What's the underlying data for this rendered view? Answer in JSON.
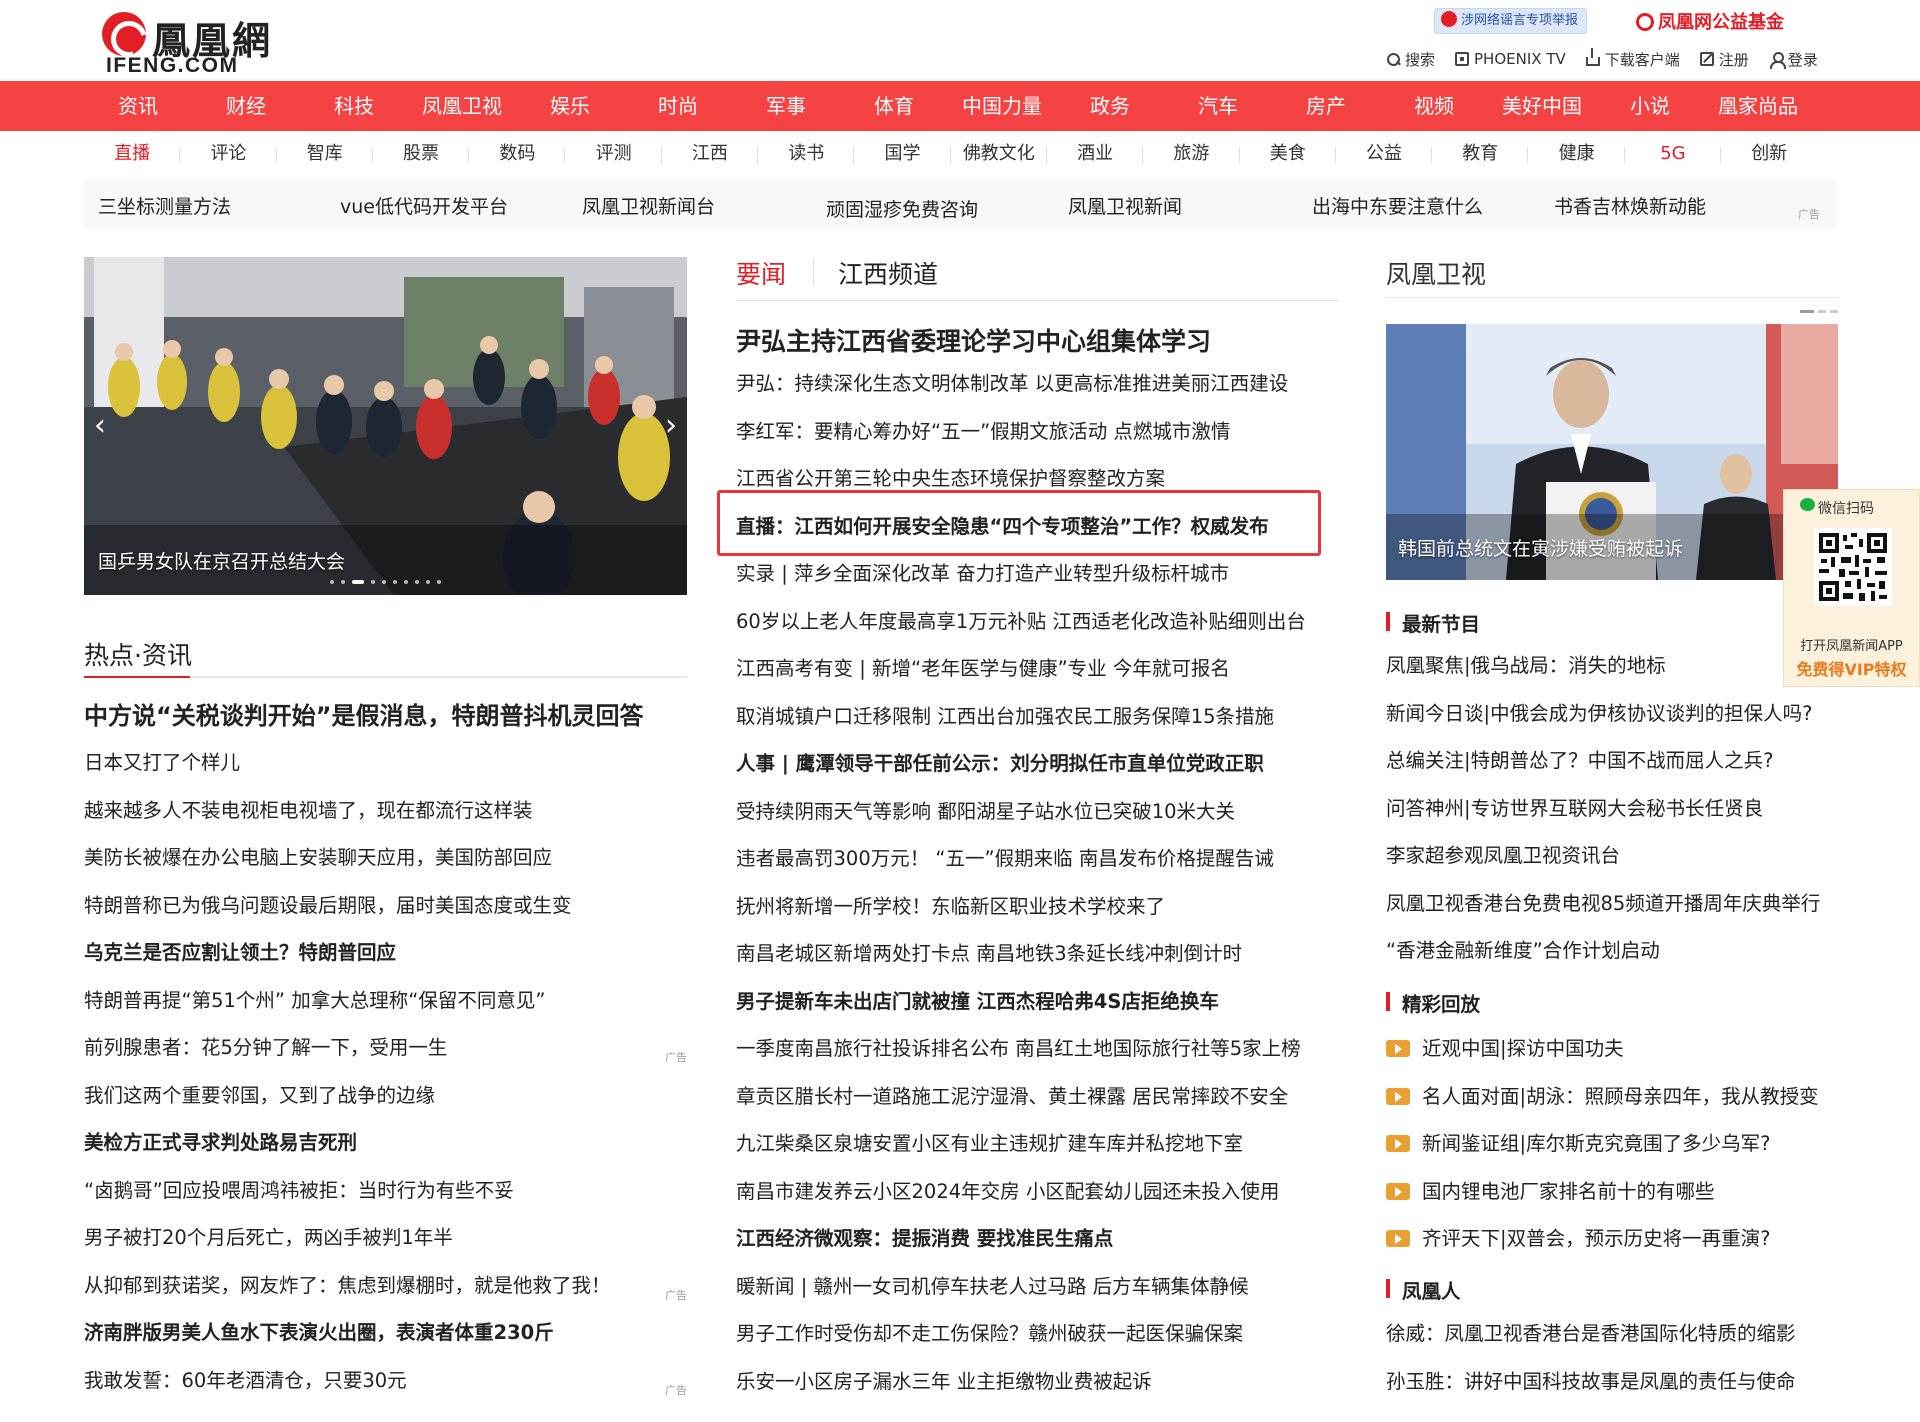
{
  "header": {
    "logo_cn": "鳳凰網",
    "logo_en": "IFENG.COM",
    "report_badge": "涉网络谣言专项举报",
    "fund": "凤凰网公益基金",
    "top_links": [
      "搜索",
      "PHOENIX TV",
      "下载客户端",
      "注册",
      "登录"
    ]
  },
  "nav_main": [
    "资讯",
    "财经",
    "科技",
    "凤凰卫视",
    "娱乐",
    "时尚",
    "军事",
    "体育",
    "中国力量",
    "政务",
    "汽车",
    "房产",
    "视频",
    "美好中国",
    "小说",
    "凰家尚品"
  ],
  "nav_sub": [
    "直播",
    "评论",
    "智库",
    "股票",
    "数码",
    "评测",
    "江西",
    "读书",
    "国学",
    "佛教文化",
    "酒业",
    "旅游",
    "美食",
    "公益",
    "教育",
    "健康",
    "5G",
    "创新"
  ],
  "ad_links": [
    "三坐标测量方法",
    "vue低代码开发平台",
    "凤凰卫视新闻台",
    "顽固湿疹免费咨询",
    "凤凰卫视新闻",
    "出海中东要注意什么",
    "书香吉林焕新动能"
  ],
  "ad_label": "广告",
  "slider": {
    "caption": "国乒男女队在京召开总结大会",
    "prev": "‹",
    "next": "›"
  },
  "hot": {
    "title": "热点·资讯",
    "items": [
      "中方说“关税谈判开始”是假消息，特朗普抖机灵回答",
      "日本又打了个样儿",
      "越来越多人不装电视柜电视墙了，现在都流行这样装",
      "美防长被爆在办公电脑上安装聊天应用，美国防部回应",
      "特朗普称已为俄乌问题设最后期限，届时美国态度或生变",
      "乌克兰是否应割让领土？特朗普回应",
      "特朗普再提“第51个州” 加拿大总理称“保留不同意见”",
      "前列腺患者：花5分钟了解一下，受用一生",
      "我们这两个重要邻国，又到了战争的边缘",
      "美检方正式寻求判处路易吉死刑",
      "“卤鹅哥”回应投喂周鸿祎被拒：当时行为有些不妥",
      "男子被打20个月后死亡，两凶手被判1年半",
      "从抑郁到获诺奖，网友炸了：焦虑到爆棚时，就是他救了我！",
      "济南胖版男美人鱼水下表演火出圈，表演者体重230斤",
      "我敢发誓：60年老酒清仓，只要30元"
    ]
  },
  "mid": {
    "tab1": "要闻",
    "tab2": "江西频道",
    "lead": "尹弘主持江西省委理论学习中心组集体学习",
    "items": [
      "尹弘：持续深化生态文明体制改革 以更高标准推进美丽江西建设",
      "李红军：要精心筹办好“五一”假期文旅活动 点燃城市激情",
      "江西省公开第三轮中央生态环境保护督察整改方案",
      "直播：江西如何开展安全隐患“四个专项整治”工作？权威发布",
      "实录 | 萍乡全面深化改革 奋力打造产业转型升级标杆城市",
      "60岁以上老人年度最高享1万元补贴 江西适老化改造补贴细则出台",
      "江西高考有变 |    新增“老年医学与健康”专业 今年就可报名",
      "取消城镇户口迁移限制 江西出台加强农民工服务保障15条措施",
      "人事 |   鹰潭领导干部任前公示：刘分明拟任市直单位党政正职",
      "受持续阴雨天气等影响 鄱阳湖星子站水位已突破10米大关",
      "违者最高罚300万元！ “五一”假期来临 南昌发布价格提醒告诫",
      "抚州将新增一所学校！东临新区职业技术学校来了",
      "南昌老城区新增两处打卡点    南昌地铁3条延长线冲刺倒计时",
      "男子提新车未出店门就被撞 江西杰程哈弗4S店拒绝换车",
      "一季度南昌旅行社投诉排名公布 南昌红土地国际旅行社等5家上榜",
      "章贡区腊长村一道路施工泥泞湿滑、黄土裸露 居民常摔跤不安全",
      "九江柴桑区泉塘安置小区有业主违规扩建车库并私挖地下室",
      "南昌市建发养云小区2024年交房 小区配套幼儿园还未投入使用",
      "江西经济微观察：提振消费 要找准民生痛点",
      "暖新闻 |    赣州一女司机停车扶老人过马路 后方车辆集体静候",
      "男子工作时受伤却不走工伤保险？赣州破获一起医保骗保案",
      "乐安一小区房子漏水三年 业主拒缴物业费被起诉"
    ]
  },
  "right": {
    "title": "凤凰卫视",
    "tv_caption": "韩国前总统文在寅涉嫌受贿被起诉",
    "sec1": "最新节目",
    "sec1_items": [
      "凤凰聚焦|俄乌战局：消失的地标",
      "新闻今日谈|中俄会成为伊核协议谈判的担保人吗?",
      "总编关注|特朗普怂了？中国不战而屈人之兵?",
      "问答神州|专访世界互联网大会秘书长任贤良",
      "李家超参观凤凰卫视资讯台",
      "凤凰卫视香港台免费电视85频道开播周年庆典举行",
      "“香港金融新维度”合作计划启动"
    ],
    "sec2": "精彩回放",
    "sec2_items": [
      "近观中国|探访中国功夫",
      "名人面对面|胡泳：照顾母亲四年，我从教授变",
      "新闻鉴证组|库尔斯克究竟围了多少乌军?",
      "国内锂电池厂家排名前十的有哪些",
      "齐评天下|双普会，预示历史将一再重演?"
    ],
    "sec3": "凤凰人",
    "sec3_items": [
      "徐威：凤凰卫视香港台是香港国际化特质的缩影",
      "孙玉胜：讲好中国科技故事是凤凰的责任与使命"
    ]
  },
  "qr": {
    "title": "微信扫码",
    "line1": "打开凤凰新闻APP",
    "line2": "免费得VIP特权"
  },
  "colors": {
    "brand_red": "#e21f26",
    "nav_red": "#f54343",
    "vip_orange": "#e97a1e"
  }
}
